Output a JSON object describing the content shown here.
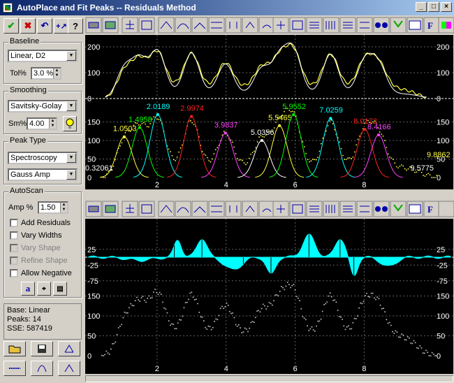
{
  "window": {
    "title": "AutoPlace and Fit Peaks -- Residuals Method",
    "min_label": "_",
    "max_label": "□",
    "close_label": "×"
  },
  "baseline": {
    "group_label": "Baseline",
    "method": "Linear, D2",
    "tol_label": "Tol%",
    "tol_value": "3.0 %"
  },
  "smoothing": {
    "group_label": "Smoothing",
    "method": "Savitsky-Golay",
    "sm_label": "Sm%",
    "sm_value": "4.00"
  },
  "peak_type": {
    "group_label": "Peak Type",
    "category": "Spectroscopy",
    "function": "Gauss Amp"
  },
  "autoscan": {
    "group_label": "AutoScan",
    "amp_label": "Amp %",
    "amp_value": "1.50",
    "options": [
      {
        "label": "Add Residuals",
        "enabled": true
      },
      {
        "label": "Vary Widths",
        "enabled": true
      },
      {
        "label": "Vary Shape",
        "enabled": false
      },
      {
        "label": "Refine Shape",
        "enabled": false
      },
      {
        "label": "Allow Negative",
        "enabled": true
      }
    ]
  },
  "status": {
    "base": "Base: Linear",
    "peaks": "Peaks:  14",
    "sse": "SSE:  587419"
  },
  "colors": {
    "yellow": "#ffff40",
    "white": "#ffffff",
    "cyan": "#00ffff",
    "green": "#00ff00",
    "red": "#ff2020",
    "magenta": "#ff40ff",
    "grid": "#606060"
  },
  "chart_data": [
    {
      "type": "line",
      "title": "",
      "x_ticks": [
        "2",
        "4",
        "6",
        "8"
      ],
      "y_ticks_top": [
        "200",
        "100",
        "0"
      ],
      "y_ticks_bottom": [
        "150",
        "100",
        "50",
        "0"
      ],
      "peak_labels": [
        {
          "x": 1.0503,
          "label": "1.0503",
          "color": "#ffff40",
          "amp": 110
        },
        {
          "x": 1.4958,
          "label": "1.4958",
          "color": "#00ff00",
          "amp": 135
        },
        {
          "x": 2.0189,
          "label": "2.0189",
          "color": "#00ffff",
          "amp": 170
        },
        {
          "x": 2.9974,
          "label": "2.9974",
          "color": "#ff2020",
          "amp": 165
        },
        {
          "x": 3.9837,
          "label": "3.9837",
          "color": "#ff40ff",
          "amp": 120
        },
        {
          "x": 5.0356,
          "label": "5.0356",
          "color": "#ffffff",
          "amp": 100
        },
        {
          "x": 5.5465,
          "label": "5.5465",
          "color": "#ffff40",
          "amp": 140
        },
        {
          "x": 5.9552,
          "label": "5.9552",
          "color": "#00ff00",
          "amp": 170
        },
        {
          "x": 7.0259,
          "label": "7.0259",
          "color": "#00ffff",
          "amp": 160
        },
        {
          "x": 8.0172,
          "label": "8.0172",
          "color": "#ff2020",
          "amp": 130
        },
        {
          "x": 8.4166,
          "label": "8.4166",
          "color": "#ff40ff",
          "amp": 115
        },
        {
          "x": 0.32061,
          "label": "0.32061",
          "color": "#ffffff",
          "amp": 0
        },
        {
          "x": 9.8862,
          "label": "9.8862",
          "color": "#ffff40",
          "amp": 0
        },
        {
          "x": 9.5775,
          "label": "9.5775",
          "color": "#ffffff",
          "amp": 0
        }
      ]
    },
    {
      "type": "area",
      "title": "",
      "y_ticks_top": [
        "25",
        "-25",
        "-75"
      ],
      "y_ticks_bottom": [
        "150",
        "100",
        "50",
        "0"
      ],
      "x_ticks": [
        "2",
        "4",
        "6",
        "8"
      ]
    }
  ]
}
